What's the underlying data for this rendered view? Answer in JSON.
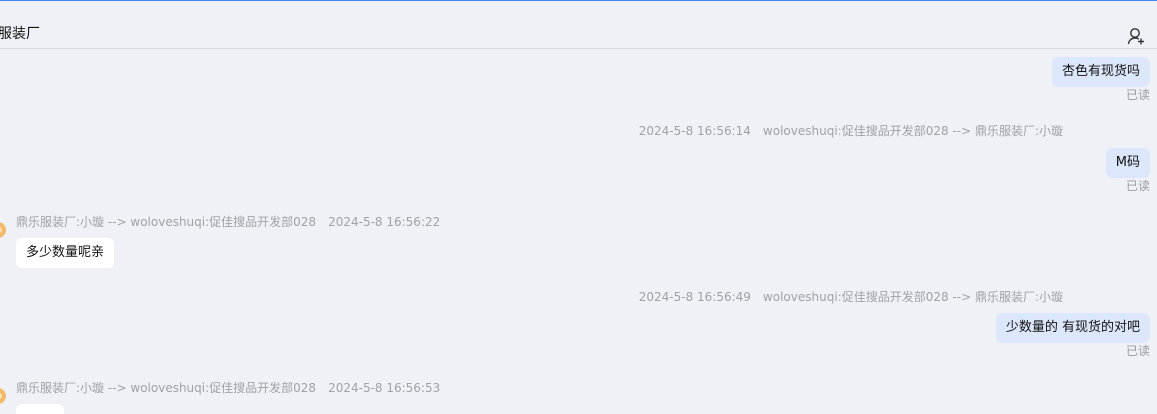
{
  "header": {
    "title": "服装厂",
    "user_icon": "user-add-icon"
  },
  "messages": [
    {
      "direction": "out",
      "text": "杏色有现货吗",
      "status": "已读"
    },
    {
      "direction": "out",
      "time": "2024-5-8 16:56:14",
      "route": "woloveshuqi:促佳搜品开发部028 --> 鼎乐服装厂:小璇",
      "text": "M码",
      "status": "已读"
    },
    {
      "direction": "in",
      "route": "鼎乐服装厂:小璇 --> woloveshuqi:促佳搜品开发部028",
      "time": "2024-5-8 16:56:22",
      "text": "多少数量呢亲"
    },
    {
      "direction": "out",
      "time": "2024-5-8 16:56:49",
      "route": "woloveshuqi:促佳搜品开发部028 --> 鼎乐服装厂:小璇",
      "text": "少数量的 有现货的对吧",
      "status": "已读"
    },
    {
      "direction": "in",
      "route": "鼎乐服装厂:小璇 --> woloveshuqi:促佳搜品开发部028",
      "time": "2024-5-8 16:56:53",
      "text": ""
    }
  ],
  "colors": {
    "accent_line": "#3f86f0",
    "outgoing_bubble": "#dde7fb",
    "incoming_bubble": "#ffffff",
    "background": "#f0f1f6"
  }
}
